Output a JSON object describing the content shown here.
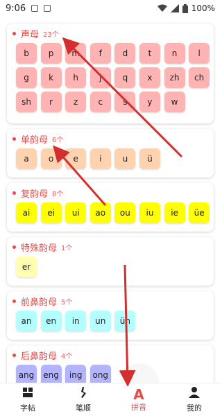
{
  "status_bar": {
    "time": "9:06",
    "battery": "100%",
    "icons": [
      "image-icon",
      "font-icon",
      "wifi-icon",
      "signal-icon",
      "battery-icon"
    ]
  },
  "accent_color": "#e64b4b",
  "sections": [
    {
      "title": "声母",
      "count": "23个",
      "tile_color": "#ffb3b3",
      "items": [
        "b",
        "p",
        "m",
        "f",
        "d",
        "t",
        "n",
        "l",
        "g",
        "k",
        "h",
        "j",
        "q",
        "x",
        "zh",
        "ch",
        "sh",
        "r",
        "z",
        "c",
        "s",
        "y",
        "w"
      ]
    },
    {
      "title": "单韵母",
      "count": "6个",
      "tile_color": "#ffd2b0",
      "items": [
        "a",
        "o",
        "e",
        "i",
        "u",
        "ü"
      ]
    },
    {
      "title": "复韵母",
      "count": "8个",
      "tile_color": "#ffff00",
      "items": [
        "ai",
        "ei",
        "ui",
        "ao",
        "ou",
        "iu",
        "ie",
        "üe"
      ]
    },
    {
      "title": "特殊韵母",
      "count": "1个",
      "tile_color": "#ffffb0",
      "items": [
        "er"
      ]
    },
    {
      "title": "前鼻韵母",
      "count": "5个",
      "tile_color": "#b3ffff",
      "items": [
        "an",
        "en",
        "in",
        "un",
        "ün"
      ]
    },
    {
      "title": "后鼻韵母",
      "count": "4个",
      "tile_color": "#b3b3ff",
      "items": [
        "ang",
        "eng",
        "ing",
        "ong"
      ]
    }
  ],
  "bottom_nav": [
    {
      "label": "字帖",
      "icon": "copybook-icon",
      "active": false
    },
    {
      "label": "笔顺",
      "icon": "stroke-order-icon",
      "active": false
    },
    {
      "label": "拼音",
      "icon": "pinyin-icon",
      "active": true,
      "glyph": "A"
    },
    {
      "label": "我的",
      "icon": "profile-icon",
      "active": false
    }
  ]
}
